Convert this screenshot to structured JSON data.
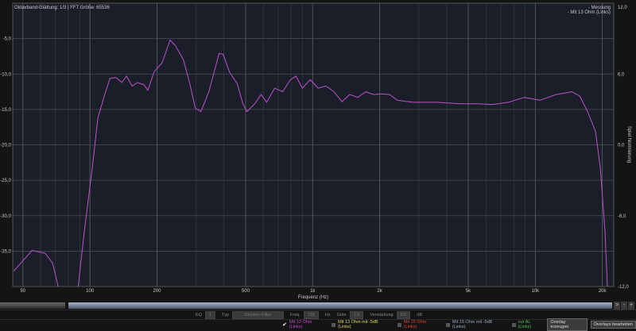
{
  "chart_data": {
    "type": "line",
    "title": "",
    "info": "Oktavband-Glättung: 1/3 | FFT Größe: 65536",
    "xlabel": "Frequenz (Hz)",
    "ylabel_right": "Spiel Normierung",
    "xscale": "log",
    "xlim": [
      45,
      22500
    ],
    "ylim": [
      -40,
      0
    ],
    "y2lim": [
      -12,
      12
    ],
    "xticks": [
      50,
      100,
      200,
      500,
      1000,
      2000,
      5000,
      10000,
      20000
    ],
    "xtick_labels": [
      "50",
      "100",
      "200",
      "500",
      "1k",
      "2k",
      "5k",
      "10k",
      "20k"
    ],
    "yticks": [
      -5,
      -10,
      -15,
      -20,
      -25,
      -30,
      -35
    ],
    "ytick_labels": [
      "-5,0",
      "-10,0",
      "-15,0",
      "-20,0",
      "-25,0",
      "-30,0",
      "-35,0"
    ],
    "y2ticks": [
      12,
      6,
      0,
      -6,
      -12
    ],
    "y2tick_labels": [
      "12,0",
      "6,0",
      "0,0",
      "-6,0",
      "-12,0"
    ],
    "grid": true,
    "legend_position": "top-right",
    "legend": [
      {
        "label": "- Messung",
        "color": "#b9c3d9"
      },
      {
        "label": "- Mit 13 Ohm (Links)",
        "color": "#d040d0"
      }
    ],
    "series": [
      {
        "name": "Mit 13 Ohm (Links)",
        "color": "#c050d0",
        "segments": [
          {
            "x": [
              45.5,
              55,
              63,
              68,
              72
            ],
            "y": [
              -37.8,
              -34.9,
              -35.3,
              -36.7,
              -40
            ]
          },
          {
            "x": [
              88.5,
              94.4,
              102.5,
              108.5,
              116,
              123,
              131,
              139,
              146,
              154.5,
              163.5,
              174.5,
              182,
              194,
              211,
              229,
              242,
              263,
              281,
              297,
              315,
              342,
              365,
              380,
              396,
              423,
              459,
              486,
              507,
              550,
              587,
              622,
              675,
              733,
              795,
              842,
              899,
              975,
              1059,
              1148,
              1247,
              1354,
              1468,
              1595,
              1730,
              1879,
              2040,
              2214,
              2404,
              2831,
              3622,
              4624,
              5454,
              6425,
              7568,
              8913,
              10500,
              12380,
              14590,
              15820,
              17170,
              18630,
              19580,
              20560,
              21070
            ],
            "y": [
              -40,
              -32.2,
              -23.2,
              -16.2,
              -13.1,
              -10.6,
              -10.5,
              -11.2,
              -10.3,
              -11.7,
              -11.2,
              -11.5,
              -12.3,
              -9.7,
              -8.4,
              -5.2,
              -6.0,
              -8.0,
              -11.4,
              -14.8,
              -15.3,
              -12.5,
              -9.2,
              -7.1,
              -7.2,
              -9.7,
              -11.4,
              -14.2,
              -15.3,
              -14.2,
              -12.9,
              -14.0,
              -12.0,
              -12.5,
              -10.8,
              -10.3,
              -12.0,
              -10.8,
              -12.0,
              -11.7,
              -12.5,
              -13.9,
              -12.9,
              -13.3,
              -12.5,
              -12.9,
              -12.8,
              -12.9,
              -13.7,
              -14.0,
              -14.0,
              -14.2,
              -14.2,
              -14.3,
              -14.0,
              -13.3,
              -13.7,
              -12.9,
              -12.5,
              -13.1,
              -15.3,
              -18.1,
              -23.2,
              -32.2,
              -40
            ]
          }
        ]
      }
    ]
  },
  "controls": {
    "eq_label": "EQ",
    "eq_value": "1",
    "typ_label": "Typ",
    "typ_value": "Glocken-Filter",
    "freq_label": "Freq.",
    "freq_value": "725",
    "freq_unit": "Hz",
    "guete_label": "Güte",
    "guete_value": "1,0",
    "gain_label": "Verstärkung",
    "gain_value": "0,0",
    "gain_unit": "dB"
  },
  "overlays": [
    {
      "label": "Mit 13 Ohm (Links)",
      "checked": true,
      "color": "#d040d0"
    },
    {
      "label": "Mit 13 Ohm mit -5dB (Links)",
      "checked": false,
      "color": "#d8d860"
    },
    {
      "label": "Mit 15 Ohm (Links)",
      "checked": false,
      "color": "#e04040"
    },
    {
      "label": "Mit 15 Ohm mit -5dB (Links)",
      "checked": false,
      "color": "#9aa8c8"
    },
    {
      "label": "nur AL (Links)",
      "checked": false,
      "color": "#50c050"
    }
  ],
  "buttons": {
    "create_overlay": "Overlay erzeugen",
    "edit_overlays": "Overlays bearbeiten"
  },
  "scroll_buttons": [
    ">",
    "-",
    "+"
  ]
}
